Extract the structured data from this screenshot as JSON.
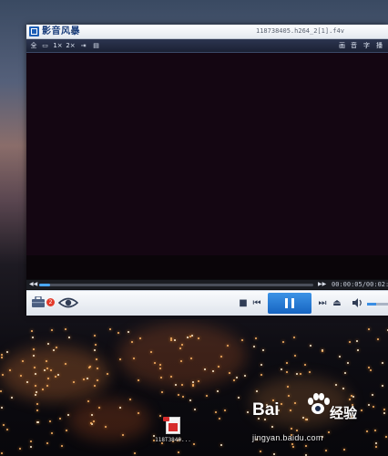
{
  "window": {
    "app_name": "影音风暴",
    "menu_caret": "▾",
    "file_title": "118738405.h264_2[1].f4v"
  },
  "toolbar": {
    "left_items": [
      {
        "label": "全",
        "name": "fullscreen-button"
      },
      {
        "label": "▭",
        "name": "compact-mode-button"
      },
      {
        "label": "1×",
        "name": "size-1x-button"
      },
      {
        "label": "2×",
        "name": "size-2x-button"
      },
      {
        "label": "⇥",
        "name": "fit-screen-button"
      },
      {
        "label": "▤",
        "name": "playlist-toggle-button"
      }
    ],
    "right_items": [
      {
        "label": "画",
        "name": "picture-settings-button"
      },
      {
        "label": "音",
        "name": "audio-settings-button"
      },
      {
        "label": "字",
        "name": "subtitle-settings-button"
      },
      {
        "label": "播",
        "name": "playback-settings-button"
      }
    ]
  },
  "seek": {
    "back_label": "◀◀",
    "forward_label": "▶▶",
    "progress_fraction": 0.04,
    "time_text": "00:00:05/00:02:02"
  },
  "controls": {
    "badge_count": "2",
    "icons": {
      "toolbox": "toolbox-icon",
      "eye": "eye-icon",
      "stop": "stop-icon",
      "prev": "previous-icon",
      "pause": "pause-icon",
      "next": "next-icon",
      "eject": "eject-icon",
      "volume": "volume-icon"
    },
    "stop_glyph": "■",
    "prev_glyph": "⏮",
    "next_glyph": "⏭",
    "eject_glyph": "⏏",
    "volume_glyph": "🔈",
    "volume_fraction": 0.45,
    "accent_color": "#1f78d6"
  },
  "desktop": {
    "file_label": "118T3840..."
  },
  "watermark": {
    "brand": "Bai",
    "cn_text": "经验",
    "url": "jingyan.baidu.com"
  }
}
